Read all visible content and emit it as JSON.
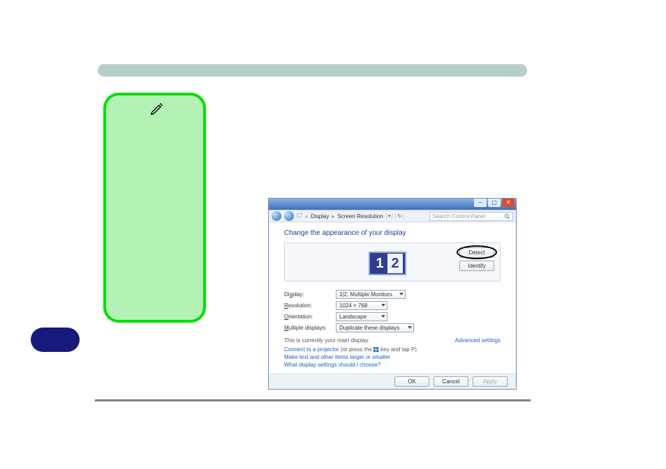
{
  "window": {
    "breadcrumb_root_icon": "≪",
    "breadcrumb_item1": "Display",
    "breadcrumb_item2": "Screen Resolution",
    "search_placeholder": "Search Control Panel",
    "heading": "Change the appearance of your display",
    "buttons": {
      "detect": "Detect",
      "identify": "Identify",
      "ok": "OK",
      "cancel": "Cancel",
      "apply": "Apply"
    },
    "form": {
      "display_label_prefix": "Di",
      "display_label_ul": "s",
      "display_label_suffix": "play:",
      "display_value": "1|2. Multiple Monitors",
      "resolution_label_ul": "R",
      "resolution_label_suffix": "esolution:",
      "resolution_value": "1024 × 768",
      "orientation_label_ul": "O",
      "orientation_label_suffix": "rientation:",
      "orientation_value": "Landscape",
      "multi_label_ul": "M",
      "multi_label_suffix": "ultiple displays:",
      "multi_value": "Duplicate these displays"
    },
    "main_display_note": "This is currently your main display.",
    "advanced_link": "Advanced settings",
    "projector_link": "Connect to a projector",
    "projector_tail": " (or press the ",
    "projector_tail2": " key and tap P)",
    "larger_link": "Make text and other items larger or smaller",
    "which_link": "What display settings should I choose?"
  },
  "monitor_labels": {
    "m1": "1",
    "m2": "2"
  }
}
